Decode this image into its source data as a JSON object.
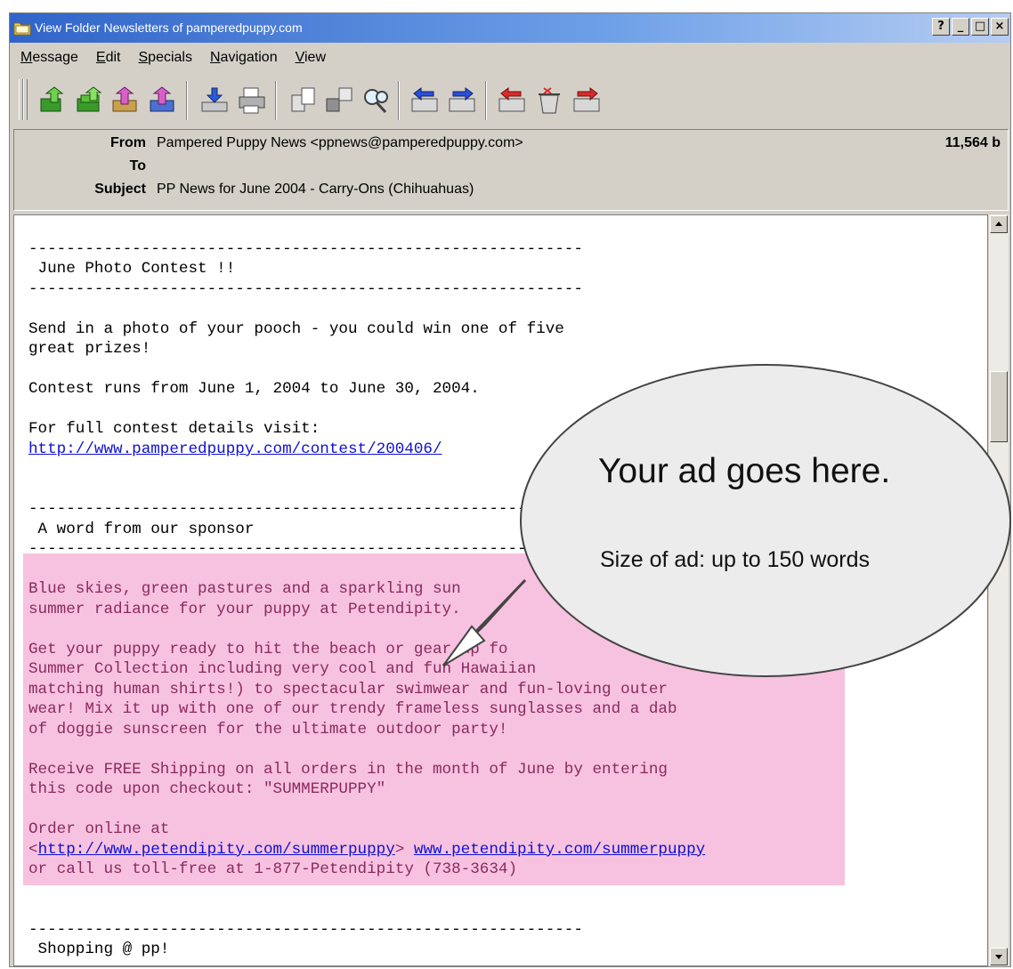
{
  "window": {
    "title": "View Folder Newsletters of pamperedpuppy.com",
    "buttons": [
      "?",
      "_",
      "□",
      "×"
    ]
  },
  "menu": [
    {
      "first": "M",
      "rest": "essage"
    },
    {
      "first": "E",
      "rest": "dit"
    },
    {
      "first": "S",
      "rest": "pecials"
    },
    {
      "first": "N",
      "rest": "avigation"
    },
    {
      "first": "V",
      "rest": "iew"
    }
  ],
  "toolbar": {
    "icons": [
      "reply-icon",
      "reply-all-icon",
      "forward-icon",
      "forward-attach-icon",
      "save-icon",
      "print-icon",
      "copy-icon",
      "move-icon",
      "find-icon",
      "prev-message-icon",
      "next-message-icon",
      "prev-unread-icon",
      "delete-icon",
      "next-unread-icon"
    ]
  },
  "header": {
    "from_label": "From",
    "from_value": "Pampered Puppy News <ppnews@pamperedpuppy.com>",
    "to_label": "To",
    "to_value": "",
    "subject_label": "Subject",
    "subject_value": "PP News for June 2004 - Carry-Ons (Chihuahuas)",
    "size": "11,564 b"
  },
  "body": {
    "rule": "-----------------------------------------------------------",
    "contest_heading": " June Photo Contest !!",
    "contest_line1": "Send in a photo of your pooch - you could win one of five",
    "contest_line2": "great prizes!",
    "contest_dates": "Contest runs from June 1, 2004 to June 30, 2004.",
    "contest_details": "For full contest details visit:",
    "contest_link": "http://www.pamperedpuppy.com/contest/200406/",
    "sponsor_heading": " A word from our sponsor",
    "sp1": "Blue skies, green pastures and a sparkling sun",
    "sp2": "summer radiance for your puppy at Petendipity.",
    "sp3": "Get your puppy ready to hit the beach or gear up fo",
    "sp4": "Summer Collection including very cool and fun Hawaiian",
    "sp5": "matching human shirts!) to spectacular swimwear and fun-loving outer",
    "sp6": "wear! Mix it up with one of our trendy frameless sunglasses and a dab",
    "sp7": "of doggie sunscreen for the ultimate outdoor party!",
    "sp8": "Receive FREE Shipping on all orders in the month of June by entering",
    "sp9": "this code upon checkout: \"SUMMERPUPPY\"",
    "sp10": "Order online at",
    "sp11_open": "<",
    "sp11_link": "http://www.petendipity.com/summerpuppy",
    "sp11_close": "> ",
    "sp11_link2": "www.petendipity.com/summerpuppy",
    "sp12": "or call us toll-free at 1-877-Petendipity (738-3634)",
    "shop_heading": " Shopping @ pp!"
  },
  "callout": {
    "headline": "Your ad goes here.",
    "size_note": "Size of ad: up to 150 words"
  }
}
